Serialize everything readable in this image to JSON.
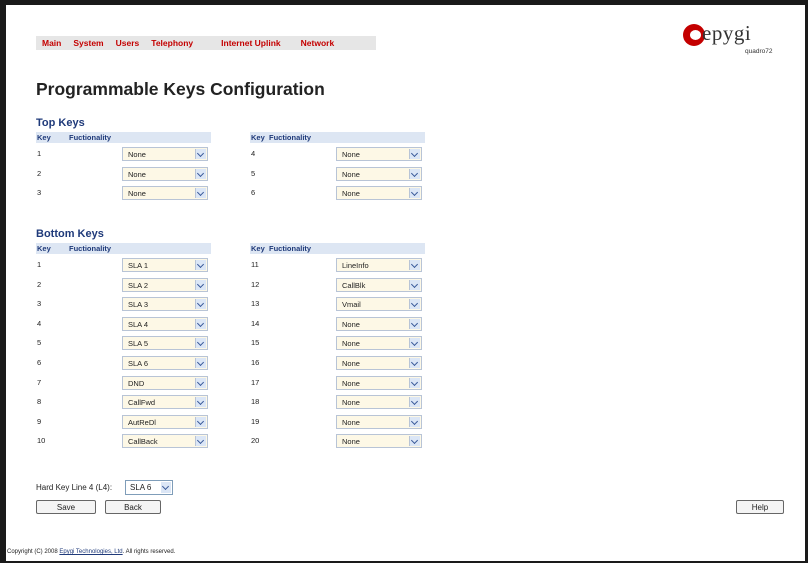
{
  "nav": {
    "items": [
      "Main",
      "System",
      "Users",
      "Telephony",
      "Internet Uplink",
      "Network"
    ]
  },
  "logo": {
    "brand": "epygi",
    "model": "quadro72"
  },
  "page_title": "Programmable Keys Configuration",
  "top_keys": {
    "title": "Top Keys",
    "col_key": "Key",
    "col_func": "Fuctionality",
    "left": [
      {
        "key": "1",
        "value": "None"
      },
      {
        "key": "2",
        "value": "None"
      },
      {
        "key": "3",
        "value": "None"
      }
    ],
    "right": [
      {
        "key": "4",
        "value": "None"
      },
      {
        "key": "5",
        "value": "None"
      },
      {
        "key": "6",
        "value": "None"
      }
    ]
  },
  "bottom_keys": {
    "title": "Bottom Keys",
    "col_key": "Key",
    "col_func": "Fuctionality",
    "left": [
      {
        "key": "1",
        "value": "SLA 1"
      },
      {
        "key": "2",
        "value": "SLA 2"
      },
      {
        "key": "3",
        "value": "SLA 3"
      },
      {
        "key": "4",
        "value": "SLA 4"
      },
      {
        "key": "5",
        "value": "SLA 5"
      },
      {
        "key": "6",
        "value": "SLA 6"
      },
      {
        "key": "7",
        "value": "DND"
      },
      {
        "key": "8",
        "value": "CallFwd"
      },
      {
        "key": "9",
        "value": "AutReDl"
      },
      {
        "key": "10",
        "value": "CallBack"
      }
    ],
    "right": [
      {
        "key": "11",
        "value": "LineInfo"
      },
      {
        "key": "12",
        "value": "CallBlk"
      },
      {
        "key": "13",
        "value": "Vmail"
      },
      {
        "key": "14",
        "value": "None"
      },
      {
        "key": "15",
        "value": "None"
      },
      {
        "key": "16",
        "value": "None"
      },
      {
        "key": "17",
        "value": "None"
      },
      {
        "key": "18",
        "value": "None"
      },
      {
        "key": "19",
        "value": "None"
      },
      {
        "key": "20",
        "value": "None"
      }
    ]
  },
  "hard_key": {
    "label": "Hard Key Line 4 (L4):",
    "value": "SLA 6"
  },
  "buttons": {
    "save": "Save",
    "back": "Back",
    "help": "Help"
  },
  "footer": {
    "prefix": "Copyright (C) 2008 ",
    "company": "Epygi Technologies, Ltd",
    "suffix": ". All rights reserved."
  },
  "colors": {
    "nav_link": "#c40000",
    "section_title": "#1f3a7a",
    "header_bg": "#dde6f3",
    "select_bg": "#fdf8e6"
  }
}
